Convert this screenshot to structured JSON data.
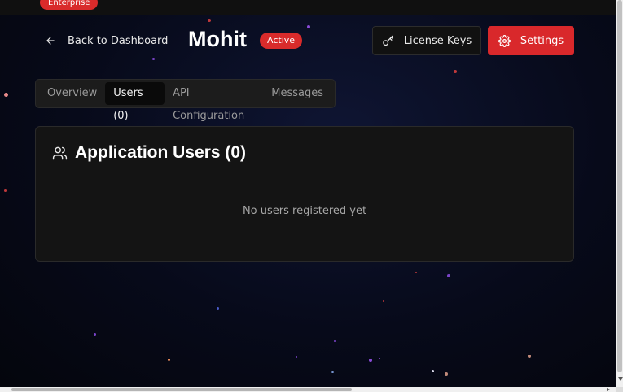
{
  "topbar": {
    "plan_badge": "Enterprise"
  },
  "header": {
    "back_label": "Back to Dashboard",
    "app_name": "Mohit",
    "status": "Active",
    "license_button": "License Keys",
    "settings_button": "Settings"
  },
  "tabs": [
    {
      "label": "Overview",
      "active": false
    },
    {
      "label": "Users (0)",
      "active": true
    },
    {
      "label": "API Configuration",
      "active": false
    },
    {
      "label": "Messages",
      "active": false
    }
  ],
  "users_card": {
    "title": "Application Users (0)",
    "empty_message": "No users registered yet"
  },
  "icons": {
    "back": "arrow-left-icon",
    "license": "key-icon",
    "settings": "gear-icon",
    "users": "users-icon"
  },
  "colors": {
    "accent": "#d9282b",
    "background": "#070a1a",
    "card": "#141414"
  }
}
